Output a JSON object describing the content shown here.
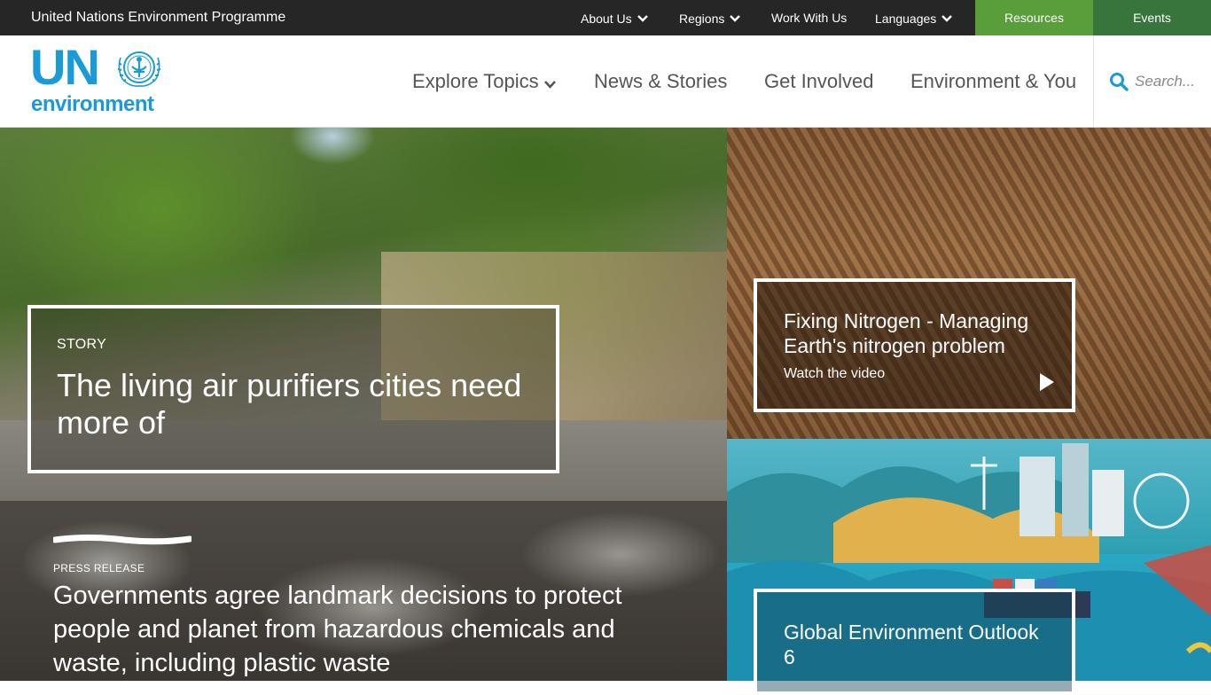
{
  "topbar": {
    "org_name": "United Nations Environment Programme",
    "links": [
      {
        "label": "About Us",
        "has_dropdown": true
      },
      {
        "label": "Regions",
        "has_dropdown": true
      },
      {
        "label": "Work With Us",
        "has_dropdown": false
      },
      {
        "label": "Languages",
        "has_dropdown": true
      }
    ],
    "resources_label": "Resources",
    "events_label": "Events",
    "colors": {
      "bar": "#262626",
      "resources": "#5a9e3c",
      "events": "#38753d"
    }
  },
  "logo": {
    "un_text": "UN",
    "env_text": "environment",
    "color": "#1a9ad7",
    "emblem_icon": "un-emblem-icon"
  },
  "nav": {
    "items": [
      {
        "label": "Explore Topics",
        "has_dropdown": true
      },
      {
        "label": "News & Stories",
        "has_dropdown": false
      },
      {
        "label": "Get Involved",
        "has_dropdown": false
      },
      {
        "label": "Environment & You",
        "has_dropdown": false
      }
    ]
  },
  "search": {
    "placeholder": "Search...",
    "icon": "search-icon",
    "icon_color": "#1a9ad7"
  },
  "tiles": {
    "feature_story": {
      "kicker": "STORY",
      "title": "The living air purifiers cities need more of"
    },
    "video": {
      "title": "Fixing Nitrogen - Managing Earth's nitrogen problem",
      "subtitle": "Watch the video",
      "icon": "play-icon"
    },
    "report": {
      "title": "Global Environment Outlook 6"
    },
    "press_release": {
      "kicker": "PRESS RELEASE",
      "title": "Governments agree landmark decisions to protect people and planet from hazardous chemicals and waste, including plastic waste"
    }
  }
}
